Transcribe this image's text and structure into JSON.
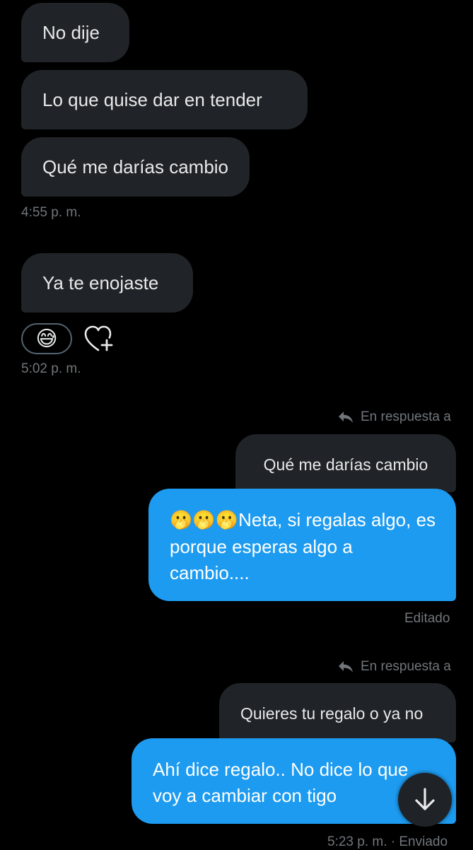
{
  "received": [
    {
      "text": "No dije"
    },
    {
      "text": "Lo que quise dar en tender"
    },
    {
      "text": "Qué me darías cambio"
    }
  ],
  "ts1": "4:55 p. m.",
  "received2": {
    "text": "Ya te enojaste"
  },
  "reaction": {
    "emoji": "😅",
    "add_icon": "heart-plus-icon"
  },
  "ts2": "5:02 p. m.",
  "reply1": {
    "label": "En respuesta a",
    "quoted": "Qué me darías cambio",
    "sent_emojis": "🫢🫢🫢",
    "sent_text": "Neta, si regalas algo, es porque esperas algo a cambio....",
    "edited": "Editado"
  },
  "reply2": {
    "label": "En respuesta a",
    "quoted": "Quieres tu regalo o ya no",
    "sent_text": "Ahí dice regalo.. No dice lo que voy a cambiar con tigo",
    "status": "5:23 p. m. · Enviado"
  },
  "colors": {
    "sent_bubble": "#1d9bf0",
    "received_bubble": "#202327",
    "muted": "#71767b"
  },
  "scroll_icon": "arrow-down-icon"
}
